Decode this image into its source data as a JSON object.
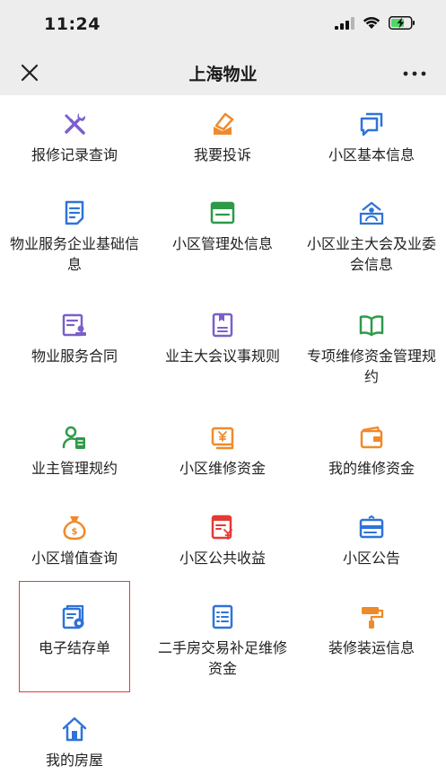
{
  "status": {
    "time": "11:24"
  },
  "nav": {
    "title": "上海物业"
  },
  "items": [
    {
      "label": "报修记录查询",
      "icon": "tools-icon"
    },
    {
      "label": "我要投诉",
      "icon": "complaint-icon"
    },
    {
      "label": "小区基本信息",
      "icon": "chat-window-icon"
    },
    {
      "label": "物业服务企业基础信息",
      "icon": "document-icon"
    },
    {
      "label": "小区管理处信息",
      "icon": "window-panel-icon"
    },
    {
      "label": "小区业主大会及业委会信息",
      "icon": "community-house-icon"
    },
    {
      "label": "物业服务合同",
      "icon": "contract-stamp-icon"
    },
    {
      "label": "业主大会议事规则",
      "icon": "rulebook-icon"
    },
    {
      "label": "专项维修资金管理规约",
      "icon": "open-book-icon"
    },
    {
      "label": "业主管理规约",
      "icon": "person-doc-icon"
    },
    {
      "label": "小区维修资金",
      "icon": "yen-bill-icon"
    },
    {
      "label": "我的维修资金",
      "icon": "wallet-icon"
    },
    {
      "label": "小区增值查询",
      "icon": "money-bag-icon"
    },
    {
      "label": "小区公共收益",
      "icon": "yen-receipt-icon"
    },
    {
      "label": "小区公告",
      "icon": "notice-card-icon"
    },
    {
      "label": "电子结存单",
      "icon": "e-statement-icon"
    },
    {
      "label": "二手房交易补足维修资金",
      "icon": "list-document-icon"
    },
    {
      "label": "装修装运信息",
      "icon": "paint-roller-icon"
    },
    {
      "label": "我的房屋",
      "icon": "home-icon"
    }
  ],
  "colors": {
    "purple": "#7b5fc9",
    "orange": "#ef8a2b",
    "blue": "#2f73d9",
    "green": "#2e9a48",
    "highlight": "#e53935"
  }
}
